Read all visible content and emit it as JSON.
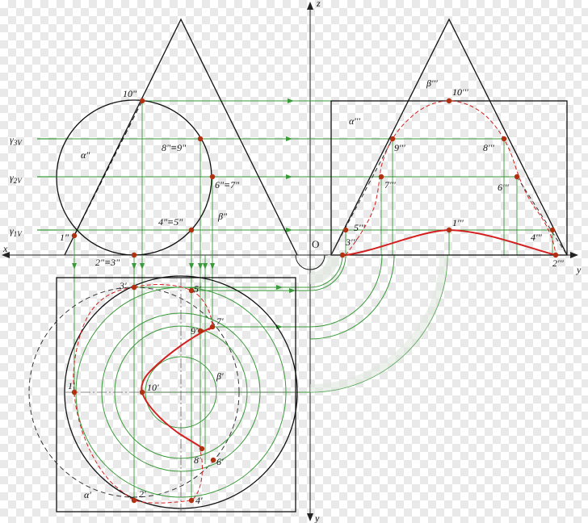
{
  "axes": {
    "x": "x",
    "y": "y",
    "z": "z",
    "y_bottom": "y",
    "origin": "O"
  },
  "colors": {
    "line": "#111111",
    "guide": "#3a9a3a",
    "curve": "#d42020",
    "point": "#b03010",
    "dashed": "#333333"
  },
  "planes_front": [
    {
      "sym": "γ",
      "sub": "3V"
    },
    {
      "sym": "γ",
      "sub": "2V"
    },
    {
      "sym": "γ",
      "sub": "1V"
    }
  ],
  "front_labels": {
    "p10": "10\"",
    "alpha": "α\"",
    "p89": "8\"≡9\"",
    "p67": "6\"≡7\"",
    "p45": "4\"≡5\"",
    "beta": "β\"",
    "p1": "1\"",
    "p23": "2\"≡3\""
  },
  "profile_labels": {
    "beta": "β'''",
    "p10": "10'''",
    "alpha": "α'''",
    "p9": "9'''",
    "p8": "8'''",
    "p7": "7'''",
    "p6": "6'''",
    "p5": "5'''",
    "p1": "1'''",
    "p3": "3'''",
    "p4": "4'''",
    "p2": "2'''"
  },
  "top_labels": {
    "p3": "3'",
    "p5": "5'",
    "p7": "7'",
    "p9": "9'",
    "p1": "1'",
    "p10": "10'",
    "beta": "β'",
    "p8": "8'",
    "p6": "6'",
    "p2": "2'",
    "p4": "4'",
    "alpha": "α'"
  }
}
